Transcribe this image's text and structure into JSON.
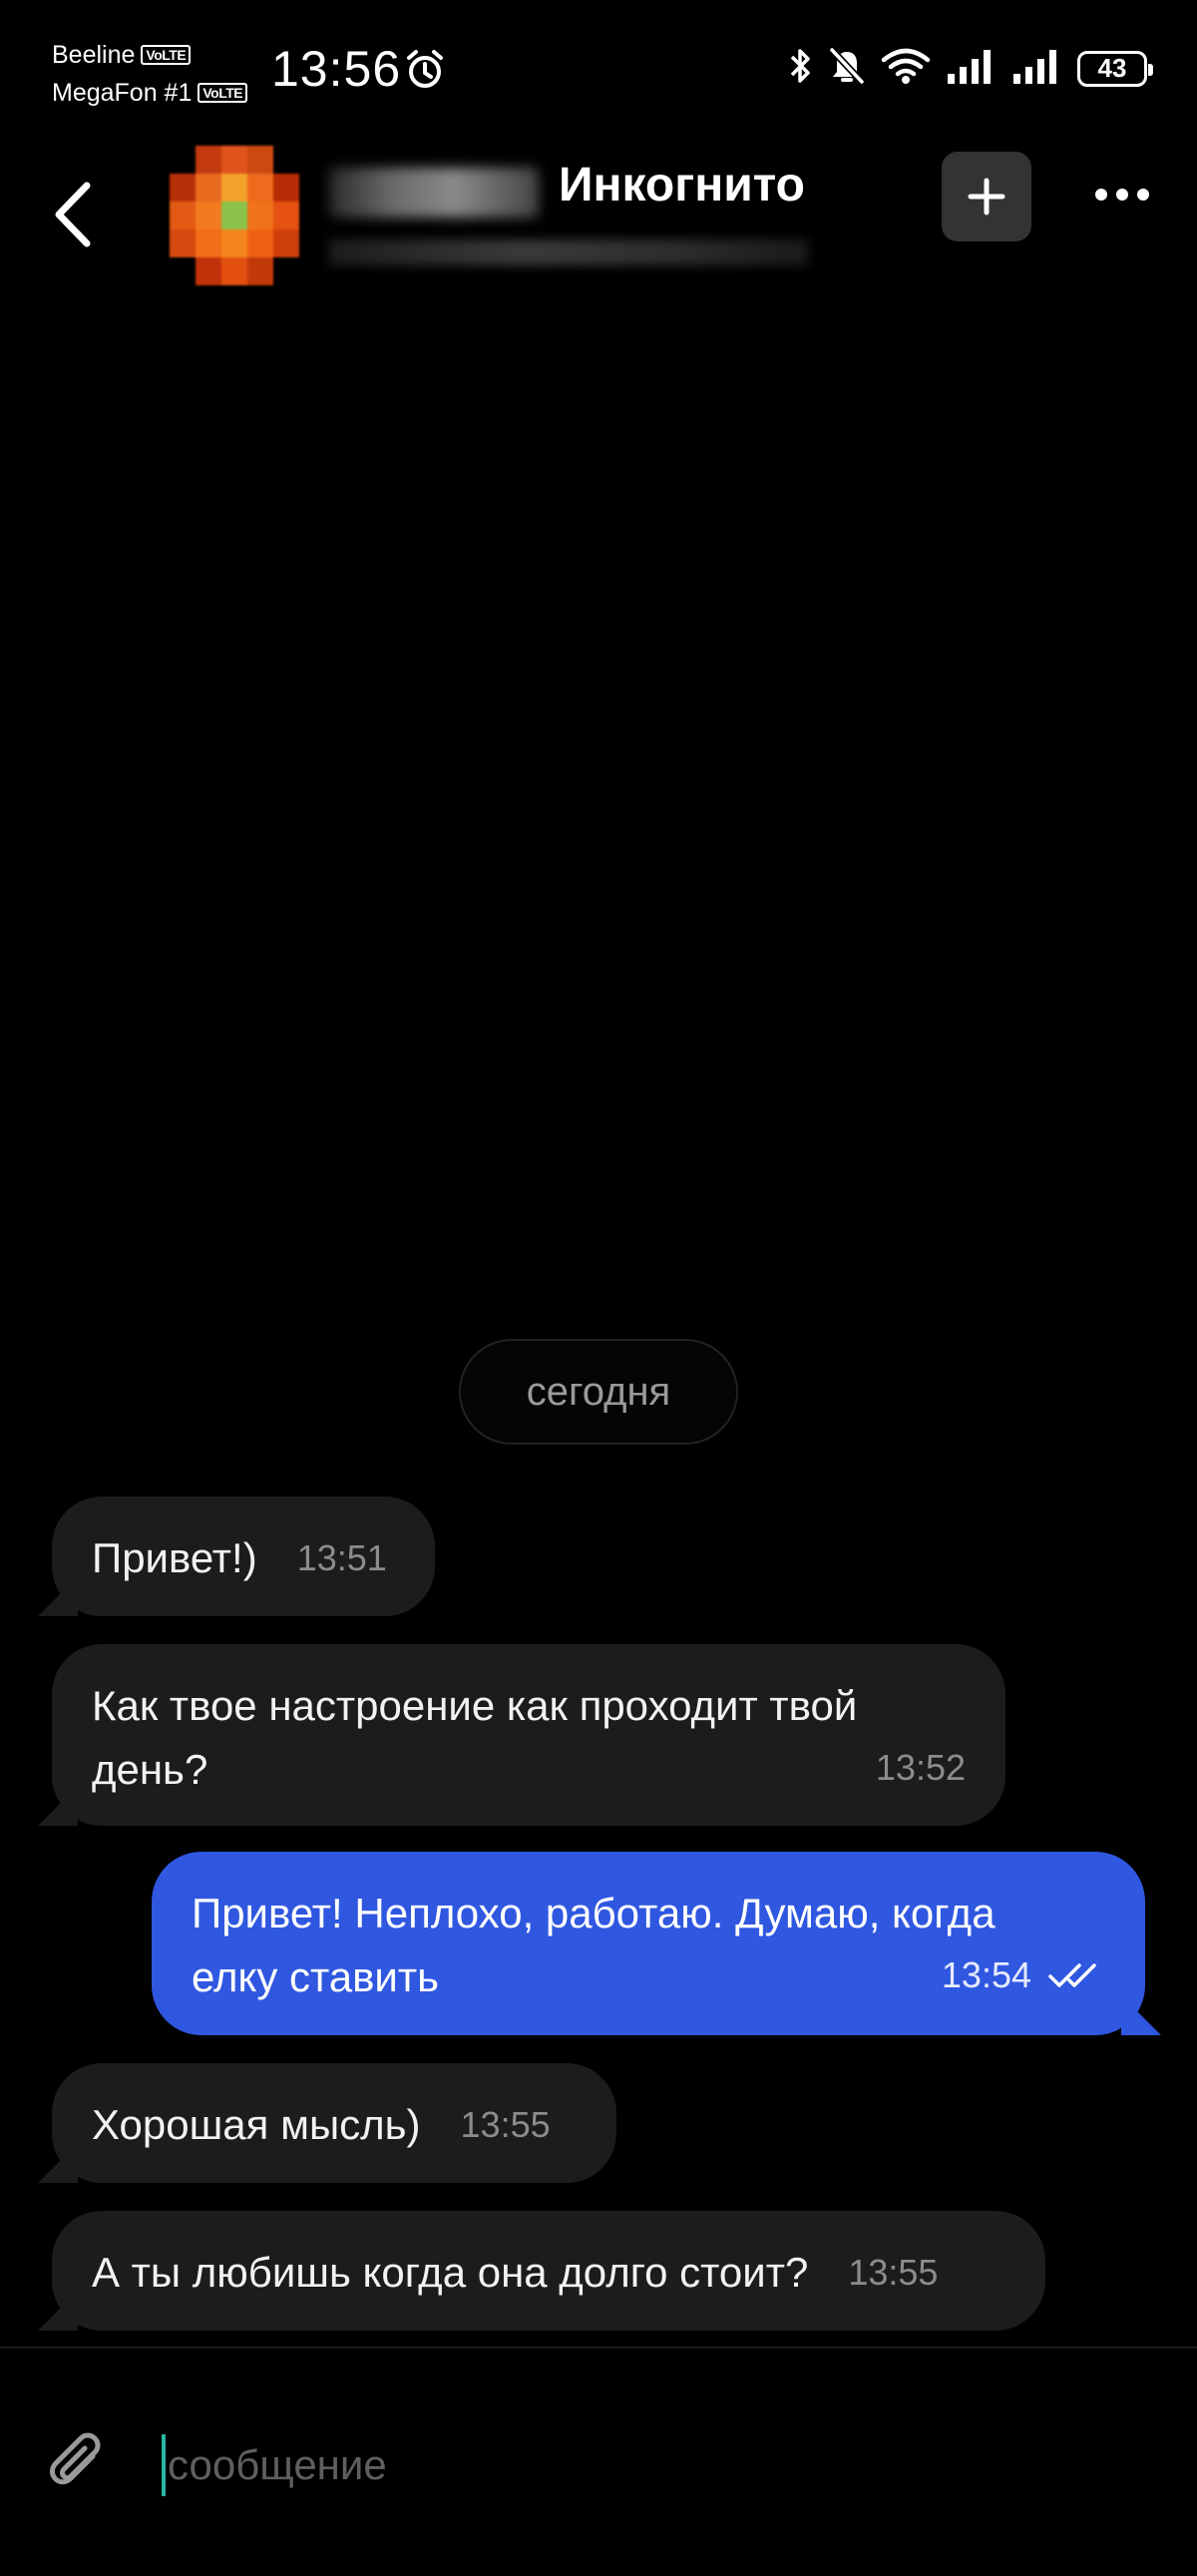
{
  "status_bar": {
    "carrier1": "Beeline",
    "carrier2": "MegaFon #1",
    "volte": "VoLTE",
    "time": "13:56",
    "battery": "43"
  },
  "header": {
    "title": "Инкогнито"
  },
  "chat": {
    "date_separator": "сегодня",
    "messages": [
      {
        "direction": "in",
        "text": "Привет!)",
        "time": "13:51"
      },
      {
        "direction": "in",
        "text": "Как твое настроение как проходит твой день?",
        "time": "13:52"
      },
      {
        "direction": "out",
        "text": "Привет! Неплохо, работаю. Думаю, когда елку ставить",
        "time": "13:54",
        "status": "read"
      },
      {
        "direction": "in",
        "text": "Хорошая мысль)",
        "time": "13:55"
      },
      {
        "direction": "in",
        "text": "А ты любишь когда она долго стоит?",
        "time": "13:55"
      }
    ]
  },
  "composer": {
    "placeholder": "сообщение"
  },
  "colors": {
    "outgoing_bubble": "#2f57e0",
    "incoming_bubble": "#1c1c1e",
    "background": "#000000"
  }
}
